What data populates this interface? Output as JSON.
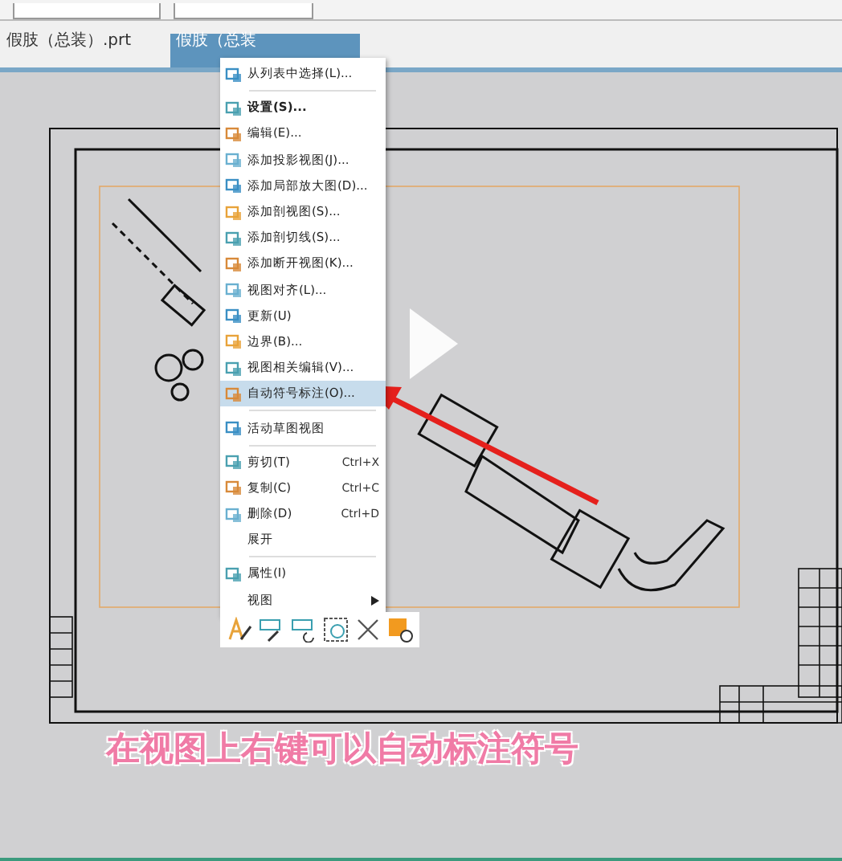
{
  "tabs": [
    {
      "label": "假肢（总装）.prt",
      "selected": false
    },
    {
      "label": "假肢（总装",
      "selected": true
    }
  ],
  "context_menu": {
    "items": [
      {
        "kind": "item",
        "label": "从列表中选择(L)...",
        "icon": true,
        "bold": false,
        "highlighted": false
      },
      {
        "kind": "separator"
      },
      {
        "kind": "item",
        "label": "设置(S)...",
        "icon": true,
        "bold": true,
        "highlighted": false
      },
      {
        "kind": "item",
        "label": "编辑(E)...",
        "icon": true,
        "bold": false,
        "highlighted": false
      },
      {
        "kind": "item",
        "label": "添加投影视图(J)...",
        "icon": true,
        "bold": false,
        "highlighted": false
      },
      {
        "kind": "item",
        "label": "添加局部放大图(D)...",
        "icon": true,
        "bold": false,
        "highlighted": false
      },
      {
        "kind": "item",
        "label": "添加剖视图(S)...",
        "icon": true,
        "bold": false,
        "highlighted": false
      },
      {
        "kind": "item",
        "label": "添加剖切线(S)...",
        "icon": true,
        "bold": false,
        "highlighted": false
      },
      {
        "kind": "item",
        "label": "添加断开视图(K)...",
        "icon": true,
        "bold": false,
        "highlighted": false
      },
      {
        "kind": "item",
        "label": "视图对齐(L)...",
        "icon": true,
        "bold": false,
        "highlighted": false
      },
      {
        "kind": "item",
        "label": "更新(U)",
        "icon": true,
        "bold": false,
        "highlighted": false
      },
      {
        "kind": "item",
        "label": "边界(B)...",
        "icon": true,
        "bold": false,
        "highlighted": false
      },
      {
        "kind": "item",
        "label": "视图相关编辑(V)...",
        "icon": true,
        "bold": false,
        "highlighted": false
      },
      {
        "kind": "item",
        "label": "自动符号标注(O)...",
        "icon": true,
        "bold": false,
        "highlighted": true
      },
      {
        "kind": "separator"
      },
      {
        "kind": "item",
        "label": "活动草图视图",
        "icon": true,
        "bold": false,
        "highlighted": false
      },
      {
        "kind": "separator"
      },
      {
        "kind": "item",
        "label": "剪切(T)",
        "shortcut": "Ctrl+X",
        "icon": true,
        "bold": false,
        "highlighted": false
      },
      {
        "kind": "item",
        "label": "复制(C)",
        "shortcut": "Ctrl+C",
        "icon": true,
        "bold": false,
        "highlighted": false
      },
      {
        "kind": "item",
        "label": "删除(D)",
        "shortcut": "Ctrl+D",
        "icon": true,
        "bold": false,
        "highlighted": false
      },
      {
        "kind": "item",
        "label": "展开",
        "icon": false,
        "bold": false,
        "highlighted": false
      },
      {
        "kind": "separator"
      },
      {
        "kind": "item",
        "label": "属性(I)",
        "icon": true,
        "bold": false,
        "highlighted": false
      },
      {
        "kind": "submenu",
        "label": "视图",
        "icon": false,
        "bold": false,
        "highlighted": false
      }
    ]
  },
  "caption": "在视图上右键可以自动标注符号"
}
